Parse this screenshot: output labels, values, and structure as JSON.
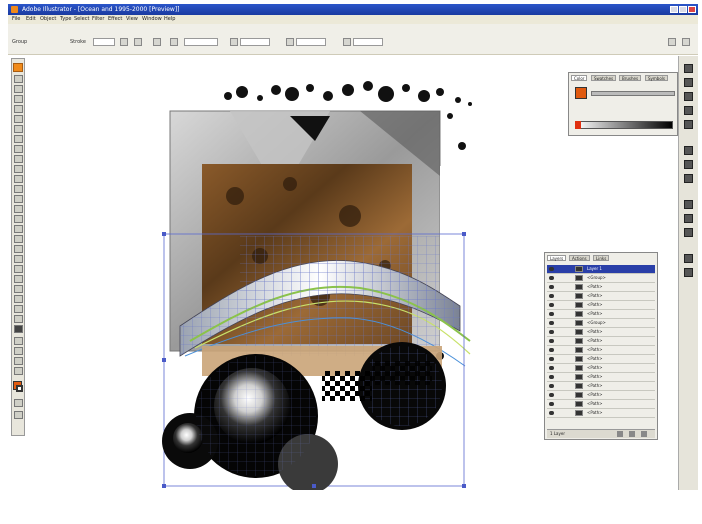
{
  "window": {
    "title": "Adobe Illustrator - [Ocean and 1995-2000 [Preview]]",
    "accent": "#1a3aa0"
  },
  "menu": {
    "items": [
      "File",
      "Edit",
      "Object",
      "Type",
      "Select",
      "Filter",
      "Effect",
      "View",
      "Window",
      "Help"
    ]
  },
  "control": {
    "selection_label": "Group",
    "stroke_label": "Stroke",
    "style_label": "Style",
    "opacity_label": "Opacity",
    "opacity_value": "100"
  },
  "color_panel": {
    "tabs": [
      "Color",
      "Swatches",
      "Brushes",
      "Symbols"
    ]
  },
  "layers_panel": {
    "tabs": [
      "Layers",
      "Actions",
      "Links"
    ],
    "rows": [
      "Layer 1",
      "<Group>",
      "<Path>",
      "<Path>",
      "<Path>",
      "<Path>",
      "<Group>",
      "<Path>",
      "<Path>",
      "<Path>",
      "<Path>",
      "<Path>",
      "<Path>",
      "<Path>",
      "<Path>",
      "<Path>",
      "<Path>"
    ],
    "footer": "1 Layer"
  },
  "icons": {
    "close": "close-icon",
    "minimize": "minimize-icon",
    "maximize": "maximize-icon"
  }
}
